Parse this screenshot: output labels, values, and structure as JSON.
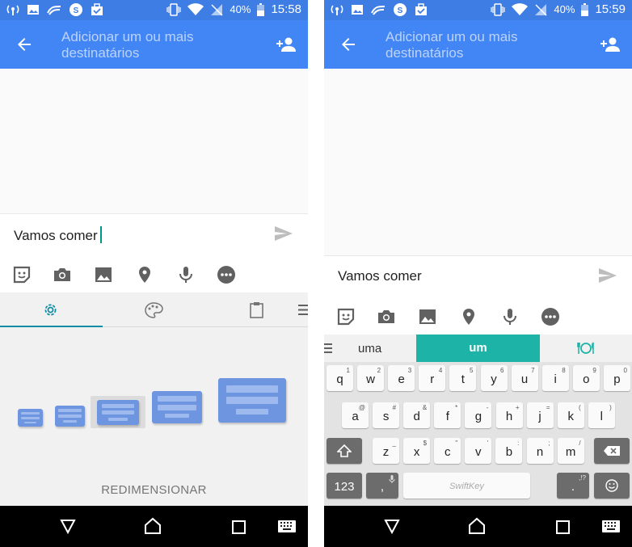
{
  "left": {
    "status": {
      "time": "15:58",
      "battery": "40%"
    },
    "appbar": {
      "title_line1": "Adicionar um ou mais",
      "title_line2": "destinatários"
    },
    "composer": {
      "text": "Vamos comer"
    },
    "resize_label": "REDIMENSIONAR"
  },
  "right": {
    "status": {
      "time": "15:59",
      "battery": "40%"
    },
    "appbar": {
      "title_line1": "Adicionar um ou mais",
      "title_line2": "destinatários"
    },
    "composer": {
      "text": "Vamos comer"
    },
    "suggestions": [
      "uma",
      "um"
    ],
    "keyboard": {
      "row1": [
        {
          "k": "q",
          "h": "1"
        },
        {
          "k": "w",
          "h": "2"
        },
        {
          "k": "e",
          "h": "3"
        },
        {
          "k": "r",
          "h": "4"
        },
        {
          "k": "t",
          "h": "5"
        },
        {
          "k": "y",
          "h": "6"
        },
        {
          "k": "u",
          "h": "7"
        },
        {
          "k": "i",
          "h": "8"
        },
        {
          "k": "o",
          "h": "9"
        },
        {
          "k": "p",
          "h": "0"
        }
      ],
      "row2": [
        {
          "k": "a",
          "h": "@"
        },
        {
          "k": "s",
          "h": "#"
        },
        {
          "k": "d",
          "h": "&"
        },
        {
          "k": "f",
          "h": "*"
        },
        {
          "k": "g",
          "h": "-"
        },
        {
          "k": "h",
          "h": "+"
        },
        {
          "k": "j",
          "h": "="
        },
        {
          "k": "k",
          "h": "("
        },
        {
          "k": "l",
          "h": ")"
        }
      ],
      "row3": [
        {
          "k": "z",
          "h": "_"
        },
        {
          "k": "x",
          "h": "$"
        },
        {
          "k": "c",
          "h": "\""
        },
        {
          "k": "v",
          "h": "'"
        },
        {
          "k": "b",
          "h": ":"
        },
        {
          "k": "n",
          "h": ";"
        },
        {
          "k": "m",
          "h": "/"
        }
      ],
      "num_label": "123",
      "comma": ",",
      "space_brand": "SwiftKey",
      "period": ".",
      "period_hint": ",!?"
    }
  },
  "colors": {
    "status_bar": "#3d7de4",
    "app_bar": "#4285f4",
    "accent": "#1db3a6",
    "keyboard_blue": "#6d95e0"
  }
}
